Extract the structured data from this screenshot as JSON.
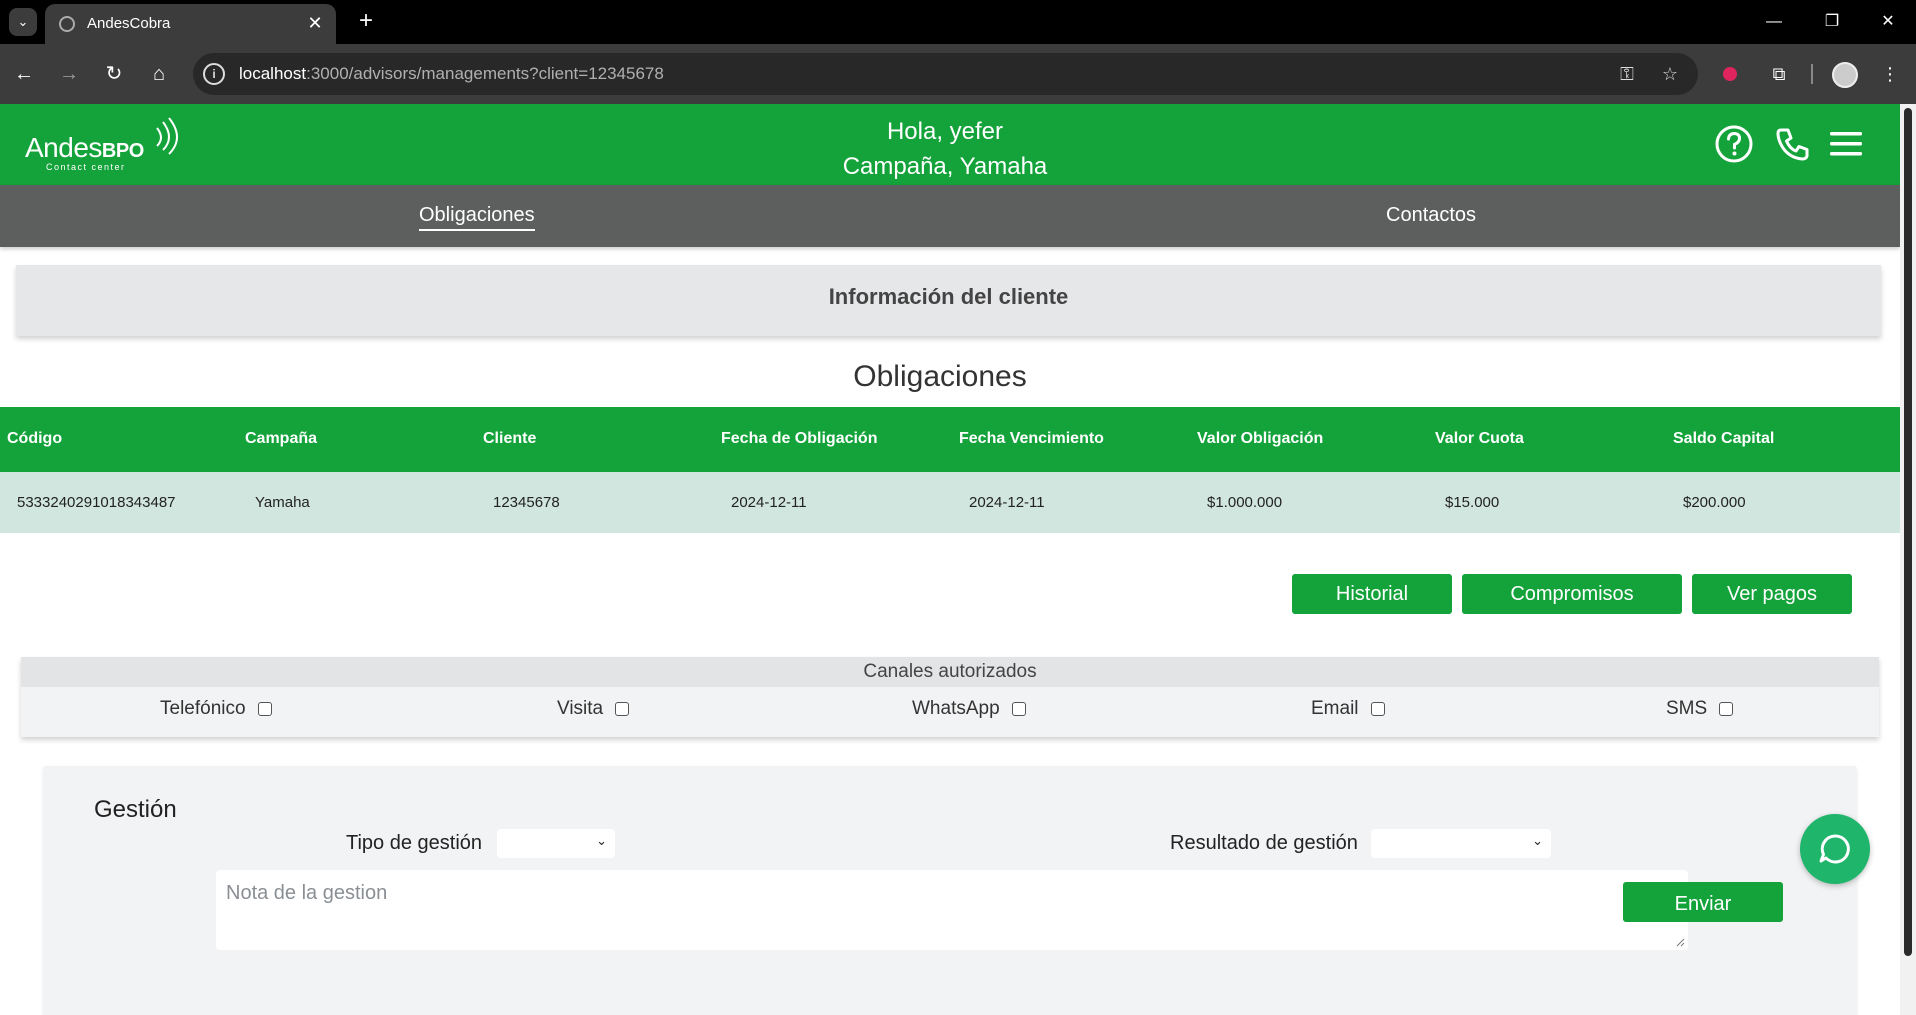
{
  "browser": {
    "tab_title": "AndesCobra",
    "url_host": "localhost",
    "url_rest": ":3000/advisors/managements?client=12345678"
  },
  "header": {
    "logo_text": "Andes",
    "logo_bpo": "BPO",
    "logo_sub": "Contact center",
    "greeting": "Hola, yefer",
    "campaign": "Campaña, Yamaha"
  },
  "nav": {
    "obligaciones": "Obligaciones",
    "contactos": "Contactos"
  },
  "client_info": {
    "title": "Información del cliente"
  },
  "obligations": {
    "title": "Obligaciones",
    "columns": [
      "Código",
      "Campaña",
      "Cliente",
      "Fecha de Obligación",
      "Fecha Vencimiento",
      "Valor Obligación",
      "Valor Cuota",
      "Saldo Capital"
    ],
    "rows": [
      [
        "5333240291018343487",
        "Yamaha",
        "12345678",
        "2024-12-11",
        "2024-12-11",
        "$1.000.000",
        "$15.000",
        "$200.000"
      ]
    ]
  },
  "actions": {
    "historial": "Historial",
    "compromisos": "Compromisos",
    "ver_pagos": "Ver pagos"
  },
  "channels": {
    "title": "Canales autorizados",
    "items": [
      "Telefónico",
      "Visita",
      "WhatsApp",
      "Email",
      "SMS"
    ]
  },
  "gestion": {
    "title": "Gestión",
    "tipo_label": "Tipo de gestión",
    "resultado_label": "Resultado de gestión",
    "nota_placeholder": "Nota de la gestion",
    "send_label": "Enviar"
  },
  "colors": {
    "brand_green": "#14a33a",
    "nav_gray": "#5c5f5e",
    "row_bg": "#d1e6de",
    "chat_green": "#1fb56b"
  }
}
